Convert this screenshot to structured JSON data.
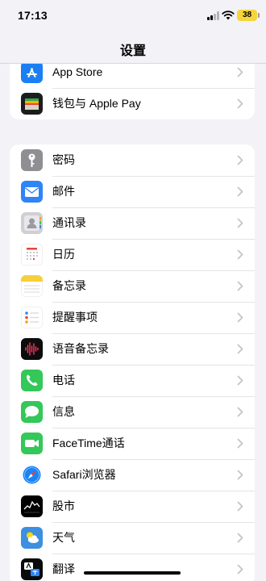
{
  "status_bar": {
    "time": "17:13",
    "battery_level": "38"
  },
  "nav": {
    "title": "设置"
  },
  "groups": [
    [
      {
        "id": "app-store",
        "label": "App Store",
        "icon": "app-store-icon",
        "color": "#1a7ff5"
      },
      {
        "id": "wallet",
        "label": "钱包与 Apple Pay",
        "icon": "wallet-icon",
        "color": "#1c1c1e"
      }
    ],
    [
      {
        "id": "passwords",
        "label": "密码",
        "icon": "key-icon",
        "color": "#8e8e93"
      },
      {
        "id": "mail",
        "label": "邮件",
        "icon": "mail-icon",
        "color": "#2f84f6"
      },
      {
        "id": "contacts",
        "label": "通讯录",
        "icon": "contacts-icon",
        "color": "#b9b9be"
      },
      {
        "id": "calendar",
        "label": "日历",
        "icon": "calendar-icon",
        "color": "#e4463c"
      },
      {
        "id": "notes",
        "label": "备忘录",
        "icon": "notes-icon",
        "color": "#f6cf3d"
      },
      {
        "id": "reminders",
        "label": "提醒事项",
        "icon": "reminders-icon",
        "color": "#ff9f0a"
      },
      {
        "id": "voice-memos",
        "label": "语音备忘录",
        "icon": "voice-memos-icon",
        "color": "#ff375f"
      },
      {
        "id": "phone",
        "label": "电话",
        "icon": "phone-icon",
        "color": "#34c759"
      },
      {
        "id": "messages",
        "label": "信息",
        "icon": "messages-icon",
        "color": "#34c759"
      },
      {
        "id": "facetime",
        "label": "FaceTime通话",
        "icon": "facetime-icon",
        "color": "#34c759"
      },
      {
        "id": "safari",
        "label": "Safari浏览器",
        "icon": "safari-icon",
        "color": "#1a84f7"
      },
      {
        "id": "stocks",
        "label": "股市",
        "icon": "stocks-icon",
        "color": "#000000"
      },
      {
        "id": "weather",
        "label": "天气",
        "icon": "weather-icon",
        "color": "#3d8fe0"
      },
      {
        "id": "translate",
        "label": "翻译",
        "icon": "translate-icon",
        "color": "#0a0a0a"
      }
    ]
  ]
}
